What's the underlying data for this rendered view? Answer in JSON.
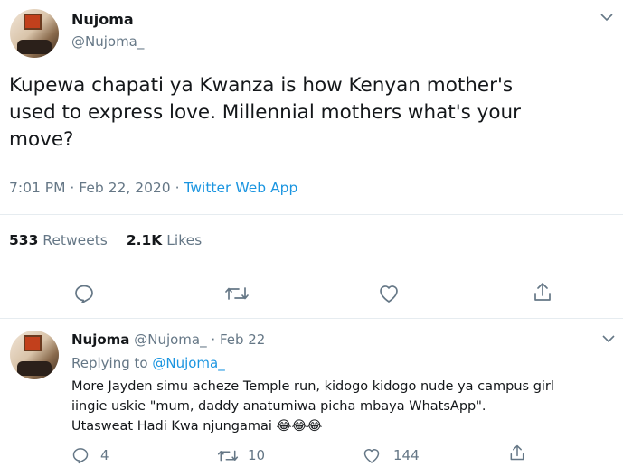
{
  "main_tweet": {
    "display_name": "Nujoma",
    "handle": "@Nujoma_",
    "text_lines": [
      "Kupewa chapati ya Kwanza is how Kenyan mother's",
      "used to express love. Millennial mothers what's your",
      "move?"
    ],
    "time": "7:01 PM",
    "date": "Feb 22, 2020",
    "source": "Twitter Web App",
    "retweets_count": "533",
    "retweets_label": "Retweets",
    "likes_count": "2.1K",
    "likes_label": "Likes"
  },
  "reply": {
    "display_name": "Nujoma",
    "handle": "@Nujoma_",
    "date": "Feb 22",
    "replying_label": "Replying to",
    "replying_handle": "@Nujoma_",
    "text_lines": [
      "More Jayden simu acheze Temple run, kidogo kidogo nude ya campus girl",
      "iingie uskie \"mum, daddy anatumiwa picha mbaya WhatsApp\".",
      "Utasweat Hadi Kwa njungamai 😂😂😂"
    ],
    "reply_count": "4",
    "retweet_count": "10",
    "like_count": "144"
  },
  "colors": {
    "text": "#14171a",
    "muted": "#657786",
    "link": "#1b95e0",
    "divider": "#e6ecf0"
  }
}
